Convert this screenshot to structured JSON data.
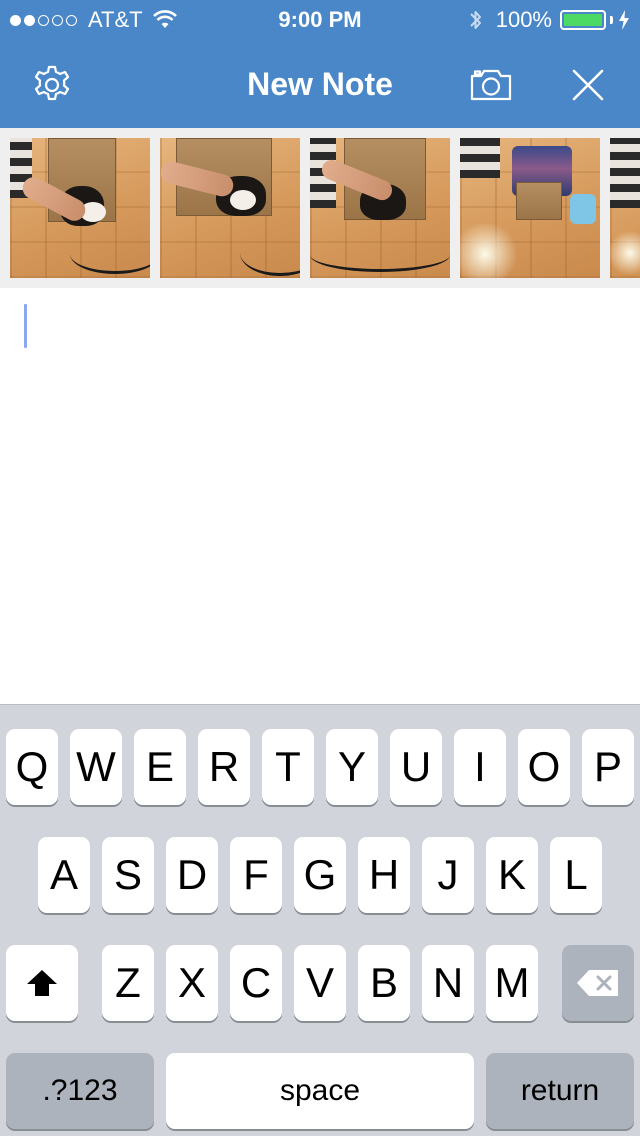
{
  "status_bar": {
    "carrier": "AT&T",
    "signal_bars_filled": 2,
    "signal_bars_total": 5,
    "time": "9:00 PM",
    "battery_percent": "100%",
    "icons": [
      "wifi-icon",
      "bluetooth-icon",
      "battery-icon",
      "charging-bolt-icon"
    ]
  },
  "navbar": {
    "title": "New Note",
    "left_icon": "gear-icon",
    "right_icons": [
      "camera-icon",
      "close-icon"
    ],
    "background_color": "#4a87c9"
  },
  "photo_strip": {
    "photos": [
      {
        "name": "photo-1",
        "description_icon": "photo-thumbnail"
      },
      {
        "name": "photo-2",
        "description_icon": "photo-thumbnail"
      },
      {
        "name": "photo-3",
        "description_icon": "photo-thumbnail"
      },
      {
        "name": "photo-4",
        "description_icon": "photo-thumbnail"
      },
      {
        "name": "photo-5",
        "description_icon": "photo-thumbnail"
      }
    ]
  },
  "note": {
    "text": ""
  },
  "keyboard": {
    "row1": [
      "Q",
      "W",
      "E",
      "R",
      "T",
      "Y",
      "U",
      "I",
      "O",
      "P"
    ],
    "row2": [
      "A",
      "S",
      "D",
      "F",
      "G",
      "H",
      "J",
      "K",
      "L"
    ],
    "row3": [
      "Z",
      "X",
      "C",
      "V",
      "B",
      "N",
      "M"
    ],
    "shift_icon": "shift-arrow-icon",
    "delete_icon": "backspace-icon",
    "numbers_label": ".?123",
    "space_label": "space",
    "return_label": "return"
  }
}
